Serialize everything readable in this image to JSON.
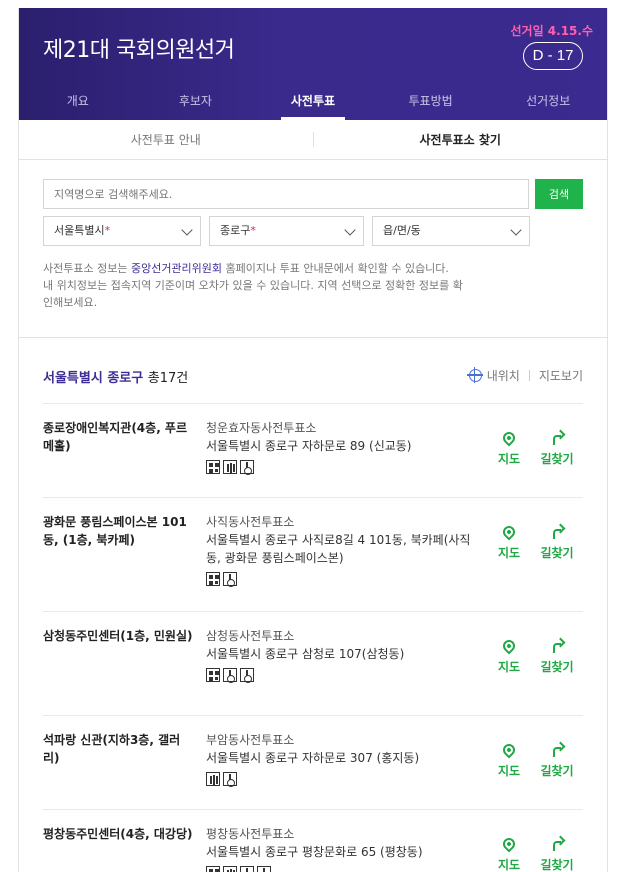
{
  "header": {
    "title": "제21대 국회의원선거",
    "election_date": "선거일 4.15.수",
    "dday": "D - 17"
  },
  "nav": [
    "개요",
    "후보자",
    "사전투표",
    "투표방법",
    "선거정보"
  ],
  "nav_active": 2,
  "subtabs": [
    "사전투표 안내",
    "사전투표소 찾기"
  ],
  "subtab_active": 1,
  "search": {
    "placeholder": "지역명으로 검색해주세요.",
    "button": "검색"
  },
  "selects": [
    {
      "value": "서울특별시",
      "required": "*"
    },
    {
      "value": "종로구",
      "required": "*"
    },
    {
      "value": "읍/면/동",
      "required": ""
    }
  ],
  "notice": {
    "line1_pre": "사전투표소 정보는 ",
    "line1_link": "중앙선거관리위원회",
    "line1_post": " 홈페이지나 투표 안내문에서 확인할 수 있습니다.",
    "line2": "내 위치정보는 접속지역 기준이며 오차가 있을 수 있습니다. 지역 선택으로 정확한 정보를 확",
    "line3": "인해보세요."
  },
  "results": {
    "region": "서울특별시 종로구",
    "count": "총17건",
    "my_location": "내위치",
    "map_view": "지도보기"
  },
  "actions": {
    "map": "지도",
    "route": "길찾기"
  },
  "places": [
    {
      "name": "종로장애인복지관(4층, 푸르메홀)",
      "station": "청운효자동사전투표소",
      "address": "서울특별시 종로구 자하문로 89 (신교동)",
      "facilities": [
        "qr-icon",
        "elevator-icon",
        "wheelchair-icon"
      ]
    },
    {
      "name": "광화문 풍림스페이스본 101동, (1층, 북카페)",
      "station": "사직동사전투표소",
      "address": "서울특별시 종로구 사직로8길 4 101동, 북카페(사직동, 광화문 풍림스페이스본)",
      "facilities": [
        "qr-icon",
        "wheelchair-icon"
      ]
    },
    {
      "name": "삼청동주민센터(1층, 민원실)",
      "station": "삼청동사전투표소",
      "address": "서울특별시 종로구 삼청로 107(삼청동)",
      "facilities": [
        "qr-icon",
        "wheelchair-icon",
        "wheelchair-icon"
      ]
    },
    {
      "name": "석파랑 신관(지하3층, 갤러리)",
      "station": "부암동사전투표소",
      "address": "서울특별시 종로구 자하문로 307 (홍지동)",
      "facilities": [
        "elevator-icon",
        "wheelchair-icon"
      ]
    },
    {
      "name": "평창동주민센터(4층, 대강당)",
      "station": "평창동사전투표소",
      "address": "서울특별시 종로구 평창문화로 65 (평창동)",
      "facilities": [
        "qr-icon",
        "elevator-icon",
        "wheelchair-icon",
        "wheelchair-icon"
      ]
    }
  ]
}
